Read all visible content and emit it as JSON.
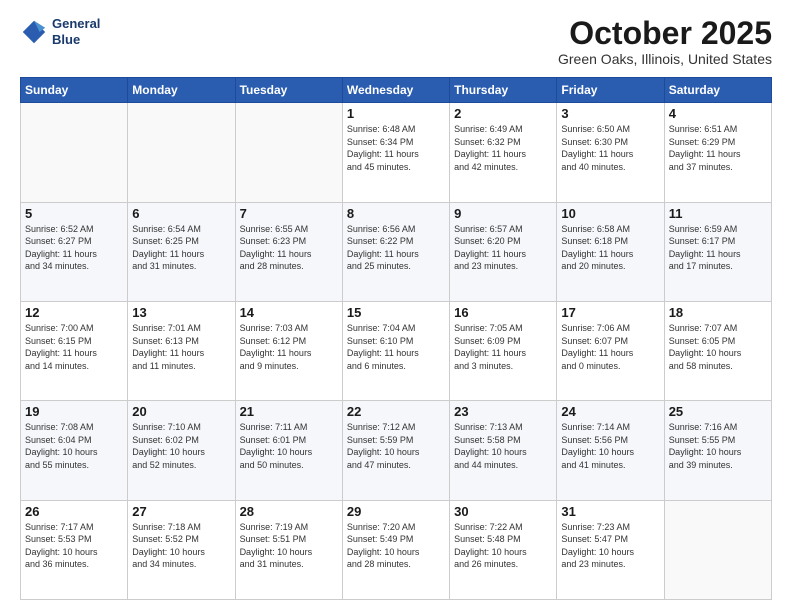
{
  "header": {
    "logo_line1": "General",
    "logo_line2": "Blue",
    "month_title": "October 2025",
    "location": "Green Oaks, Illinois, United States"
  },
  "days_of_week": [
    "Sunday",
    "Monday",
    "Tuesday",
    "Wednesday",
    "Thursday",
    "Friday",
    "Saturday"
  ],
  "weeks": [
    [
      {
        "day": "",
        "info": ""
      },
      {
        "day": "",
        "info": ""
      },
      {
        "day": "",
        "info": ""
      },
      {
        "day": "1",
        "info": "Sunrise: 6:48 AM\nSunset: 6:34 PM\nDaylight: 11 hours\nand 45 minutes."
      },
      {
        "day": "2",
        "info": "Sunrise: 6:49 AM\nSunset: 6:32 PM\nDaylight: 11 hours\nand 42 minutes."
      },
      {
        "day": "3",
        "info": "Sunrise: 6:50 AM\nSunset: 6:30 PM\nDaylight: 11 hours\nand 40 minutes."
      },
      {
        "day": "4",
        "info": "Sunrise: 6:51 AM\nSunset: 6:29 PM\nDaylight: 11 hours\nand 37 minutes."
      }
    ],
    [
      {
        "day": "5",
        "info": "Sunrise: 6:52 AM\nSunset: 6:27 PM\nDaylight: 11 hours\nand 34 minutes."
      },
      {
        "day": "6",
        "info": "Sunrise: 6:54 AM\nSunset: 6:25 PM\nDaylight: 11 hours\nand 31 minutes."
      },
      {
        "day": "7",
        "info": "Sunrise: 6:55 AM\nSunset: 6:23 PM\nDaylight: 11 hours\nand 28 minutes."
      },
      {
        "day": "8",
        "info": "Sunrise: 6:56 AM\nSunset: 6:22 PM\nDaylight: 11 hours\nand 25 minutes."
      },
      {
        "day": "9",
        "info": "Sunrise: 6:57 AM\nSunset: 6:20 PM\nDaylight: 11 hours\nand 23 minutes."
      },
      {
        "day": "10",
        "info": "Sunrise: 6:58 AM\nSunset: 6:18 PM\nDaylight: 11 hours\nand 20 minutes."
      },
      {
        "day": "11",
        "info": "Sunrise: 6:59 AM\nSunset: 6:17 PM\nDaylight: 11 hours\nand 17 minutes."
      }
    ],
    [
      {
        "day": "12",
        "info": "Sunrise: 7:00 AM\nSunset: 6:15 PM\nDaylight: 11 hours\nand 14 minutes."
      },
      {
        "day": "13",
        "info": "Sunrise: 7:01 AM\nSunset: 6:13 PM\nDaylight: 11 hours\nand 11 minutes."
      },
      {
        "day": "14",
        "info": "Sunrise: 7:03 AM\nSunset: 6:12 PM\nDaylight: 11 hours\nand 9 minutes."
      },
      {
        "day": "15",
        "info": "Sunrise: 7:04 AM\nSunset: 6:10 PM\nDaylight: 11 hours\nand 6 minutes."
      },
      {
        "day": "16",
        "info": "Sunrise: 7:05 AM\nSunset: 6:09 PM\nDaylight: 11 hours\nand 3 minutes."
      },
      {
        "day": "17",
        "info": "Sunrise: 7:06 AM\nSunset: 6:07 PM\nDaylight: 11 hours\nand 0 minutes."
      },
      {
        "day": "18",
        "info": "Sunrise: 7:07 AM\nSunset: 6:05 PM\nDaylight: 10 hours\nand 58 minutes."
      }
    ],
    [
      {
        "day": "19",
        "info": "Sunrise: 7:08 AM\nSunset: 6:04 PM\nDaylight: 10 hours\nand 55 minutes."
      },
      {
        "day": "20",
        "info": "Sunrise: 7:10 AM\nSunset: 6:02 PM\nDaylight: 10 hours\nand 52 minutes."
      },
      {
        "day": "21",
        "info": "Sunrise: 7:11 AM\nSunset: 6:01 PM\nDaylight: 10 hours\nand 50 minutes."
      },
      {
        "day": "22",
        "info": "Sunrise: 7:12 AM\nSunset: 5:59 PM\nDaylight: 10 hours\nand 47 minutes."
      },
      {
        "day": "23",
        "info": "Sunrise: 7:13 AM\nSunset: 5:58 PM\nDaylight: 10 hours\nand 44 minutes."
      },
      {
        "day": "24",
        "info": "Sunrise: 7:14 AM\nSunset: 5:56 PM\nDaylight: 10 hours\nand 41 minutes."
      },
      {
        "day": "25",
        "info": "Sunrise: 7:16 AM\nSunset: 5:55 PM\nDaylight: 10 hours\nand 39 minutes."
      }
    ],
    [
      {
        "day": "26",
        "info": "Sunrise: 7:17 AM\nSunset: 5:53 PM\nDaylight: 10 hours\nand 36 minutes."
      },
      {
        "day": "27",
        "info": "Sunrise: 7:18 AM\nSunset: 5:52 PM\nDaylight: 10 hours\nand 34 minutes."
      },
      {
        "day": "28",
        "info": "Sunrise: 7:19 AM\nSunset: 5:51 PM\nDaylight: 10 hours\nand 31 minutes."
      },
      {
        "day": "29",
        "info": "Sunrise: 7:20 AM\nSunset: 5:49 PM\nDaylight: 10 hours\nand 28 minutes."
      },
      {
        "day": "30",
        "info": "Sunrise: 7:22 AM\nSunset: 5:48 PM\nDaylight: 10 hours\nand 26 minutes."
      },
      {
        "day": "31",
        "info": "Sunrise: 7:23 AM\nSunset: 5:47 PM\nDaylight: 10 hours\nand 23 minutes."
      },
      {
        "day": "",
        "info": ""
      }
    ]
  ]
}
